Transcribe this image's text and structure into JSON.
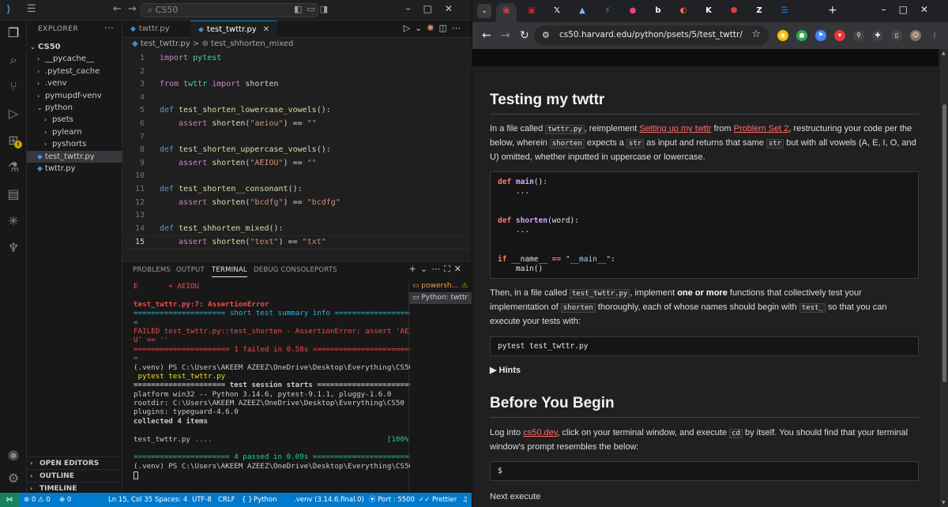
{
  "vscode": {
    "search_placeholder": "CS50",
    "explorer_title": "EXPLORER",
    "tree": {
      "root": "CS50",
      "items": [
        {
          "label": "__pycache__",
          "indent": 1,
          "folder": true
        },
        {
          "label": ".pytest_cache",
          "indent": 1,
          "folder": true
        },
        {
          "label": ".venv",
          "indent": 1,
          "folder": true
        },
        {
          "label": "pymupdf-venv",
          "indent": 1,
          "folder": true
        },
        {
          "label": "python",
          "indent": 1,
          "folder": true,
          "open": true
        },
        {
          "label": "psets",
          "indent": 2,
          "folder": true
        },
        {
          "label": "pylearn",
          "indent": 2,
          "folder": true
        },
        {
          "label": "pyshorts",
          "indent": 2,
          "folder": true
        },
        {
          "label": "test_twttr.py",
          "indent": 1,
          "folder": false,
          "selected": true
        },
        {
          "label": "twttr.py",
          "indent": 1,
          "folder": false
        }
      ]
    },
    "sidebar_sections": [
      "OPEN EDITORS",
      "OUTLINE",
      "TIMELINE"
    ],
    "tabs": [
      {
        "label": "twttr.py",
        "active": false
      },
      {
        "label": "test_twttr.py",
        "active": true
      }
    ],
    "breadcrumb": {
      "file": "test_twttr.py",
      "separator": ">",
      "symbol": "test_shhorten_mixed"
    },
    "code_lines": [
      "import pytest",
      "",
      "from twttr import shorten",
      "",
      "def test_shorten_lowercase_vowels():",
      "    assert shorten(\"aeiou\") == \"\"",
      "",
      "def test_shorten_uppercase_vowels():",
      "    assert shorten(\"AEIOU\") == \"\"",
      "",
      "def test_shorten__consonant():",
      "    assert shorten(\"bcdfg\") == \"bcdfg\"",
      "",
      "def test_shhorten_mixed():",
      "    assert shorten(\"text\") == \"txt\""
    ],
    "current_line": 15,
    "panel_tabs": [
      "PROBLEMS",
      "OUTPUT",
      "TERMINAL",
      "DEBUG CONSOLE",
      "PORTS"
    ],
    "active_panel_tab": "TERMINAL",
    "terminal_lines": [
      {
        "text": "E       + AEIOU",
        "style": "red"
      },
      {
        "text": "",
        "style": ""
      },
      {
        "text": "test_twttr.py:7: AssertionError",
        "style": "red-bold"
      },
      {
        "text": "===================== short test summary info ====================",
        "style": "cyan"
      },
      {
        "text": "=",
        "style": "cyan"
      },
      {
        "text": "FAILED test_twttr.py::test_shorten - AssertionError: assert 'AEIO",
        "style": "red"
      },
      {
        "text": "U' == ''",
        "style": "red"
      },
      {
        "text": "====================== 1 failed in 0.58s ========================",
        "style": "red"
      },
      {
        "text": "=",
        "style": "red"
      },
      {
        "text": "(.venv) PS C:\\Users\\AKEEM AZEEZ\\OneDrive\\Desktop\\Everything\\CS50>",
        "style": ""
      },
      {
        "text": " pytest test_twttr.py",
        "style": "yellow"
      },
      {
        "text": "===================== test session starts ======================",
        "style": "bold"
      },
      {
        "text": "platform win32 -- Python 3.14.6, pytest-9.1.1, pluggy-1.6.0",
        "style": ""
      },
      {
        "text": "rootdir: C:\\Users\\AKEEM AZEEZ\\OneDrive\\Desktop\\Everything\\CS50",
        "style": ""
      },
      {
        "text": "plugins: typeguard-4.6.0",
        "style": ""
      },
      {
        "text": "collected 4 items",
        "style": "bold"
      },
      {
        "text": "",
        "style": ""
      },
      {
        "text": "test_twttr.py ....                                        [100%]",
        "style": "pass"
      },
      {
        "text": "",
        "style": ""
      },
      {
        "text": "====================== 4 passed in 0.09s =======================",
        "style": "green"
      },
      {
        "text": "(.venv) PS C:\\Users\\AKEEM AZEEZ\\OneDrive\\Desktop\\Everything\\CS50>",
        "style": ""
      }
    ],
    "terminal_list": [
      {
        "label": "powersh...",
        "warn": true
      },
      {
        "label": "Python: twttr",
        "warn": false
      }
    ],
    "status": {
      "errors": "0",
      "warnings": "0",
      "position": "Ln 15, Col 35",
      "spaces": "Spaces: 4",
      "encoding": "UTF-8",
      "eol": "CRLF",
      "braces": "{ }",
      "language": "Python",
      "interpreter": ".venv (3.14.6.final.0)",
      "port": "Port : 5500",
      "prettier": "Prettier"
    }
  },
  "chrome": {
    "url": "cs50.harvard.edu/python/psets/5/test_twttr/",
    "tab_icons": [
      {
        "glyph": "▣",
        "color": "#e53935"
      },
      {
        "glyph": "▣",
        "color": "#c62828"
      },
      {
        "glyph": "𝕏",
        "color": "#ffffff"
      },
      {
        "glyph": "▲",
        "color": "#8ab4f8"
      },
      {
        "glyph": "⚡",
        "color": "#4caf50"
      },
      {
        "glyph": "●",
        "color": "#ec407a"
      },
      {
        "glyph": "b",
        "color": "#ffffff"
      },
      {
        "glyph": "◐",
        "color": "#ff7043"
      },
      {
        "glyph": "K",
        "color": "#ffffff"
      },
      {
        "glyph": "⬢",
        "color": "#e53935"
      },
      {
        "glyph": "Z",
        "color": "#ffffff"
      },
      {
        "glyph": "☰",
        "color": "#1e88e5"
      }
    ],
    "page": {
      "h1": "Testing my twttr",
      "p1_a": "In a file called ",
      "p1_code1": "twttr.py",
      "p1_b": ", reimplement ",
      "p1_link1": "Setting up my twttr",
      "p1_c": " from ",
      "p1_link2": "Problem Set 2",
      "p1_d": ", restructuring your code per the below, wherein ",
      "p1_code2": "shorten",
      "p1_e": " expects a ",
      "p1_code3": "str",
      "p1_f": " as input and returns that same ",
      "p1_code4": "str",
      "p1_g": " but with all vowels (A, E, I, O, and U) omitted, whether inputted in uppercase or lowercase.",
      "code1": [
        [
          [
            "def",
            "kw"
          ],
          [
            " ",
            ""
          ],
          [
            "main",
            "fn"
          ],
          [
            "():",
            ""
          ]
        ],
        [
          [
            "    ...",
            ""
          ]
        ],
        [
          [
            "",
            ""
          ]
        ],
        [
          [
            "",
            ""
          ]
        ],
        [
          [
            "def",
            "kw"
          ],
          [
            " ",
            ""
          ],
          [
            "shorten",
            "fn"
          ],
          [
            "(word):",
            ""
          ]
        ],
        [
          [
            "    ...",
            ""
          ]
        ],
        [
          [
            "",
            ""
          ]
        ],
        [
          [
            "",
            ""
          ]
        ],
        [
          [
            "if",
            "kw"
          ],
          [
            " __name__ ",
            ""
          ],
          [
            "==",
            "kw"
          ],
          [
            " ",
            ""
          ],
          [
            "\"__main__\"",
            "str"
          ],
          [
            ":",
            ""
          ]
        ],
        [
          [
            "    main()",
            ""
          ]
        ]
      ],
      "p2_a": "Then, in a file called ",
      "p2_code1": "test_twttr.py",
      "p2_b": ", implement ",
      "p2_bold": "one or more",
      "p2_c": " functions that collectively test your implementation of ",
      "p2_code2": "shorten",
      "p2_d": " thoroughly, each of whose names should begin with ",
      "p2_code3": "test_",
      "p2_e": " so that you can execute your tests with:",
      "code2": "pytest test_twttr.py",
      "hints": "Hints",
      "h2": "Before You Begin",
      "p3_a": "Log into ",
      "p3_link": "cs50.dev",
      "p3_b": ", click on your terminal window, and execute ",
      "p3_code": "cd",
      "p3_c": " by itself. You should find that your terminal window's prompt resembles the below:",
      "code3": "$",
      "p4": "Next execute"
    }
  }
}
